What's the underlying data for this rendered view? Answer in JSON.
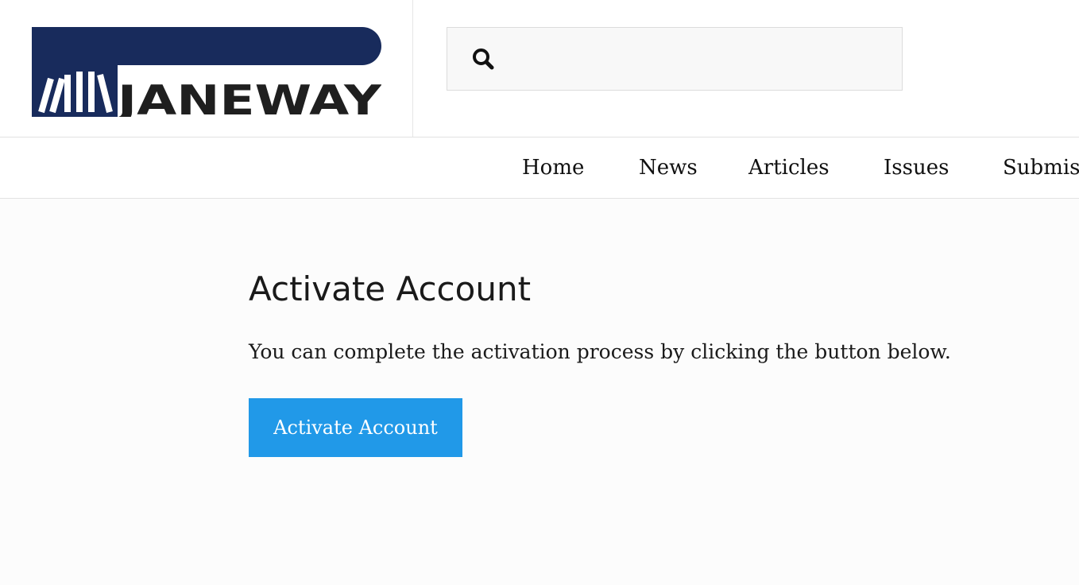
{
  "header": {
    "logo_text": "JANEWAY",
    "logo_colors": {
      "banner": "#182b5c",
      "text": "#1f1f1f",
      "background": "#ffffff"
    },
    "search": {
      "icon": "search-icon",
      "value": "",
      "placeholder": ""
    }
  },
  "nav": {
    "items": [
      {
        "label": "Home"
      },
      {
        "label": "News"
      },
      {
        "label": "Articles"
      },
      {
        "label": "Issues"
      },
      {
        "label": "Submis"
      }
    ]
  },
  "main": {
    "title": "Activate Account",
    "text": "You can complete the activation process by clicking the button below.",
    "button_label": "Activate Account",
    "button_color": "#2199e8"
  }
}
